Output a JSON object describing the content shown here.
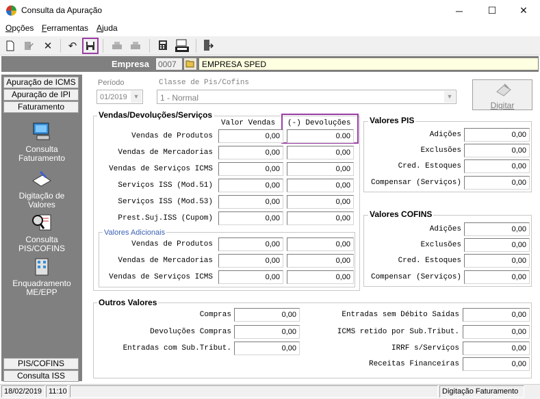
{
  "window": {
    "title": "Consulta da Apuração",
    "minimize": "─",
    "maximize": "☐",
    "close": "✕"
  },
  "menu": [
    {
      "first": "O",
      "rest": "pções"
    },
    {
      "first": "F",
      "rest": "erramentas"
    },
    {
      "first": "A",
      "rest": "juda"
    }
  ],
  "empresa": {
    "label": "Empresa",
    "code": "0007",
    "name": "EMPRESA SPED"
  },
  "sidebar": {
    "tabs": [
      "Apuração de ICMS",
      "Apuração de IPI",
      "Faturamento"
    ],
    "items": [
      "Consulta Faturamento",
      "Digitação de Valores",
      "Consulta PIS/COFINS",
      "Enquadramento ME/EPP"
    ],
    "bottom_tabs": [
      "PIS/COFINS",
      "Consulta ISS"
    ]
  },
  "filter": {
    "periodo_label": "Período",
    "periodo_value": "01/2019",
    "classe_label": "Classe de Pis/Cofins",
    "classe_value": "1 - Normal",
    "digitar_label": "Digitar"
  },
  "vendas": {
    "title": "Vendas/Devoluções/Serviços",
    "col_valor": "Valor Vendas",
    "col_devol": "(-) Devoluções",
    "rows": [
      {
        "label": "Vendas de Produtos",
        "valor": "0,00",
        "devol": "0.00"
      },
      {
        "label": "Vendas de Mercadorias",
        "valor": "0,00",
        "devol": "0,00"
      },
      {
        "label": "Vendas de Serviços ICMS",
        "valor": "0,00",
        "devol": "0,00"
      },
      {
        "label": "Serviços ISS (Mod.51)",
        "valor": "0,00",
        "devol": "0,00"
      },
      {
        "label": "Serviços ISS (Mod.53)",
        "valor": "0,00",
        "devol": "0,00"
      },
      {
        "label": "Prest.Suj.ISS (Cupom)",
        "valor": "0,00",
        "devol": "0,00"
      }
    ],
    "adicionais_title": "Valores Adicionais",
    "adicionais": [
      {
        "label": "Vendas de Produtos",
        "valor": "0,00",
        "devol": "0,00"
      },
      {
        "label": "Vendas de Mercadorias",
        "valor": "0,00",
        "devol": "0,00"
      },
      {
        "label": "Vendas de Serviços ICMS",
        "valor": "0,00",
        "devol": "0,00"
      }
    ]
  },
  "pis": {
    "title": "Valores PIS",
    "rows": [
      {
        "label": "Adições",
        "value": "0,00"
      },
      {
        "label": "Exclusões",
        "value": "0,00"
      },
      {
        "label": "Cred. Estoques",
        "value": "0,00"
      },
      {
        "label": "Compensar (Serviços)",
        "value": "0,00"
      }
    ]
  },
  "cofins": {
    "title": "Valores COFINS",
    "rows": [
      {
        "label": "Adições",
        "value": "0,00"
      },
      {
        "label": "Exclusões",
        "value": "0,00"
      },
      {
        "label": "Cred. Estoques",
        "value": "0,00"
      },
      {
        "label": "Compensar (Serviços)",
        "value": "0,00"
      }
    ]
  },
  "outros": {
    "title": "Outros Valores",
    "left": [
      {
        "label": "Compras",
        "value": "0,00"
      },
      {
        "label": "Devoluções Compras",
        "value": "0,00"
      },
      {
        "label": "Entradas com Sub.Tribut.",
        "value": "0,00"
      }
    ],
    "right": [
      {
        "label": "Entradas sem Débito Saídas",
        "value": "0,00"
      },
      {
        "label": "ICMS retido por Sub.Tribut.",
        "value": "0,00"
      },
      {
        "label": "IRRF s/Serviços",
        "value": "0,00"
      },
      {
        "label": "Receitas Financeiras",
        "value": "0,00"
      }
    ]
  },
  "status": {
    "date": "18/02/2019",
    "time": "11:10",
    "message": "Digitação Faturamento"
  },
  "colors": {
    "highlight": "#9a3ca3",
    "empresa_name_bg": "#ffffe1",
    "sidebar_bg": "#808080"
  }
}
